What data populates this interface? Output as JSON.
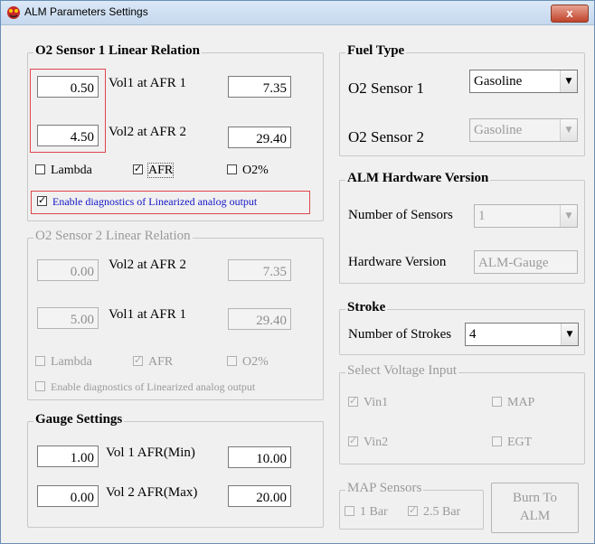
{
  "window": {
    "title": "ALM Parameters Settings",
    "close_label": "x"
  },
  "o2s1": {
    "legend": "O2 Sensor 1 Linear Relation",
    "v1": "0.50",
    "v1_label": "Vol1  at  AFR 1",
    "afr1": "7.35",
    "v2": "4.50",
    "v2_label": "Vol2  at  AFR 2",
    "afr2": "29.40",
    "lambda": "Lambda",
    "afr": "AFR",
    "o2pct": "O2%",
    "diag": "Enable diagnostics of Linearized analog output"
  },
  "o2s2": {
    "legend": "O2 Sensor 2 Linear Relation",
    "v1": "0.00",
    "v1_label": "Vol2  at  AFR 2",
    "afr1": "7.35",
    "v2": "5.00",
    "v2_label": "Vol1  at  AFR 1",
    "afr2": "29.40",
    "lambda": "Lambda",
    "afr": "AFR",
    "o2pct": "O2%",
    "diag": "Enable diagnostics of Linearized analog output"
  },
  "gauge": {
    "legend": "Gauge Settings",
    "v1": "1.00",
    "v1_label": "Vol 1   AFR(Min)",
    "afr_min": "10.00",
    "v2": "0.00",
    "v2_label": "Vol 2   AFR(Max)",
    "afr_max": "20.00"
  },
  "fuel": {
    "legend": "Fuel Type",
    "s1_label": "O2 Sensor 1",
    "s1_value": "Gasoline",
    "s2_label": "O2 Sensor 2",
    "s2_value": "Gasoline"
  },
  "hw": {
    "legend": "ALM Hardware Version",
    "sensors_label": "Number of Sensors",
    "sensors_value": "1",
    "version_label": "Hardware Version",
    "version_value": "ALM-Gauge"
  },
  "stroke": {
    "legend": "Stroke",
    "label": "Number of Strokes",
    "value": "4"
  },
  "voltage": {
    "legend": "Select Voltage Input",
    "vin1": "Vin1",
    "map": "MAP",
    "vin2": "Vin2",
    "egt": "EGT"
  },
  "map_sensors": {
    "legend": "MAP Sensors",
    "bar1": "1 Bar",
    "bar25": "2.5 Bar"
  },
  "burn": {
    "line1": "Burn To",
    "line2": "ALM"
  },
  "colors": {
    "highlight_border": "#e0454d",
    "diag_text": "#1414c8",
    "disabled_text": "#9a9a9a"
  }
}
